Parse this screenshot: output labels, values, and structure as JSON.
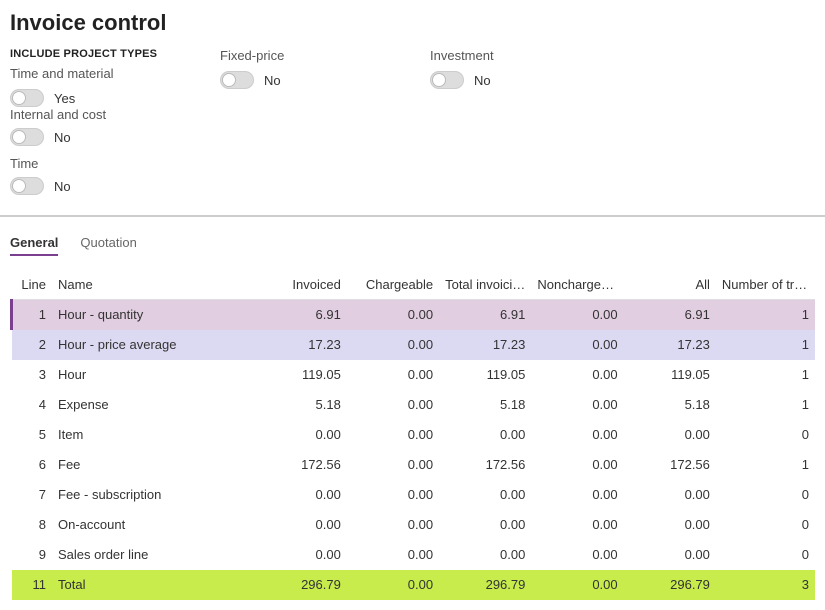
{
  "title": "Invoice control",
  "filters": {
    "include_label": "INCLUDE PROJECT TYPES",
    "time_and_material": {
      "label": "Time and material",
      "value": "Yes"
    },
    "fixed_price": {
      "label": "Fixed-price",
      "value": "No"
    },
    "investment": {
      "label": "Investment",
      "value": "No"
    },
    "internal_cost": {
      "label": "Internal and cost",
      "value": "No"
    },
    "time": {
      "label": "Time",
      "value": "No"
    }
  },
  "tabs": {
    "general": "General",
    "quotation": "Quotation"
  },
  "columns": {
    "line": "Line",
    "name": "Name",
    "invoiced": "Invoiced",
    "chargeable": "Chargeable",
    "total_invoicing": "Total invoicing",
    "nonchargeable": "Nonchargeable",
    "all": "All",
    "num_tra": "Number of tra…"
  },
  "rows": [
    {
      "line": "1",
      "name": "Hour - quantity",
      "invoiced": "6.91",
      "chargeable": "0.00",
      "total": "6.91",
      "nonchg": "0.00",
      "all": "6.91",
      "num": "1",
      "style": "sel-dark"
    },
    {
      "line": "2",
      "name": "Hour - price average",
      "invoiced": "17.23",
      "chargeable": "0.00",
      "total": "17.23",
      "nonchg": "0.00",
      "all": "17.23",
      "num": "1",
      "style": "sel-light"
    },
    {
      "line": "3",
      "name": "Hour",
      "invoiced": "119.05",
      "chargeable": "0.00",
      "total": "119.05",
      "nonchg": "0.00",
      "all": "119.05",
      "num": "1",
      "style": ""
    },
    {
      "line": "4",
      "name": "Expense",
      "invoiced": "5.18",
      "chargeable": "0.00",
      "total": "5.18",
      "nonchg": "0.00",
      "all": "5.18",
      "num": "1",
      "style": ""
    },
    {
      "line": "5",
      "name": "Item",
      "invoiced": "0.00",
      "chargeable": "0.00",
      "total": "0.00",
      "nonchg": "0.00",
      "all": "0.00",
      "num": "0",
      "style": ""
    },
    {
      "line": "6",
      "name": "Fee",
      "invoiced": "172.56",
      "chargeable": "0.00",
      "total": "172.56",
      "nonchg": "0.00",
      "all": "172.56",
      "num": "1",
      "style": ""
    },
    {
      "line": "7",
      "name": "Fee - subscription",
      "invoiced": "0.00",
      "chargeable": "0.00",
      "total": "0.00",
      "nonchg": "0.00",
      "all": "0.00",
      "num": "0",
      "style": ""
    },
    {
      "line": "8",
      "name": "On-account",
      "invoiced": "0.00",
      "chargeable": "0.00",
      "total": "0.00",
      "nonchg": "0.00",
      "all": "0.00",
      "num": "0",
      "style": ""
    },
    {
      "line": "9",
      "name": "Sales order line",
      "invoiced": "0.00",
      "chargeable": "0.00",
      "total": "0.00",
      "nonchg": "0.00",
      "all": "0.00",
      "num": "0",
      "style": ""
    },
    {
      "line": "11",
      "name": "Total",
      "invoiced": "296.79",
      "chargeable": "0.00",
      "total": "296.79",
      "nonchg": "0.00",
      "all": "296.79",
      "num": "3",
      "style": "total"
    }
  ]
}
